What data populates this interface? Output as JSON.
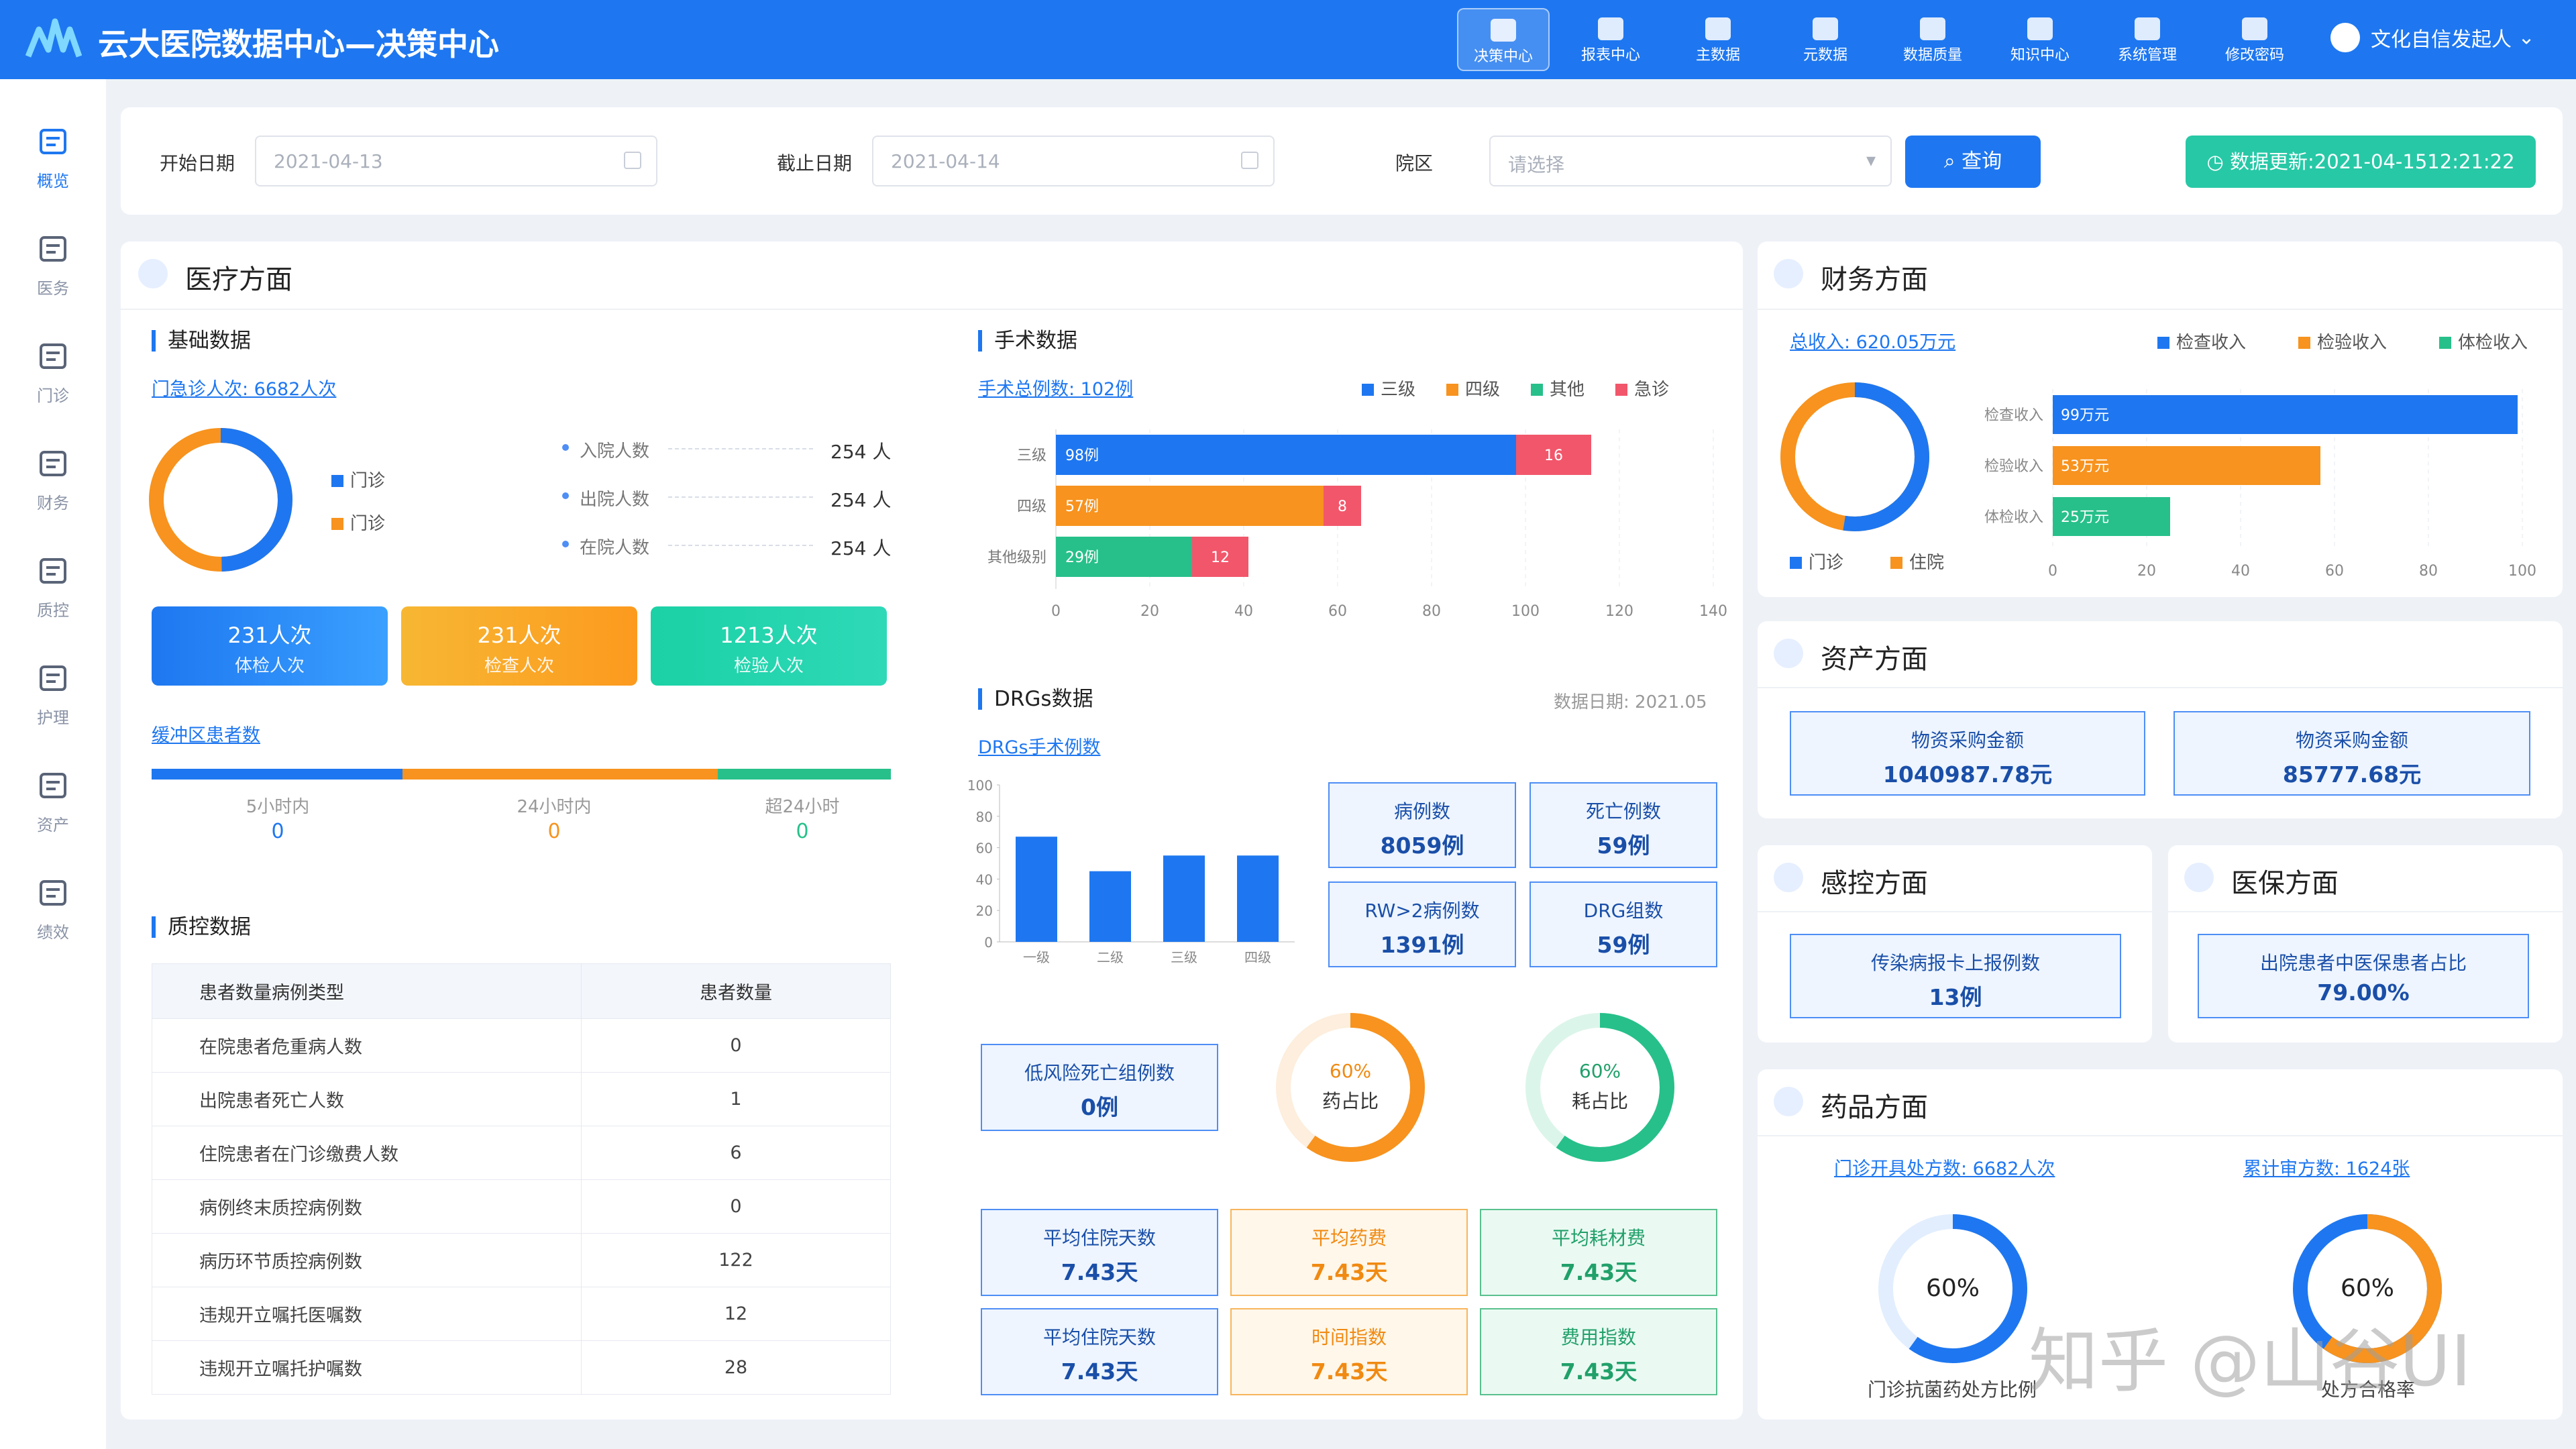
{
  "header": {
    "title": "云大医院数据中心—决策中心",
    "nav": [
      {
        "label": "决策中心",
        "icon": "decision-icon"
      },
      {
        "label": "报表中心",
        "icon": "pie-icon"
      },
      {
        "label": "主数据",
        "icon": "database-icon"
      },
      {
        "label": "元数据",
        "icon": "cubes-icon"
      },
      {
        "label": "数据质量",
        "icon": "shield-icon"
      },
      {
        "label": "知识中心",
        "icon": "book-icon"
      },
      {
        "label": "系统管理",
        "icon": "gear-icon"
      },
      {
        "label": "修改密码",
        "icon": "lock-icon"
      }
    ],
    "user": "文化自信发起人"
  },
  "sidebar": [
    {
      "label": "概览",
      "icon": "overview-icon"
    },
    {
      "label": "医务",
      "icon": "doctor-icon"
    },
    {
      "label": "门诊",
      "icon": "stethoscope-icon"
    },
    {
      "label": "财务",
      "icon": "finance-icon"
    },
    {
      "label": "质控",
      "icon": "quality-icon"
    },
    {
      "label": "护理",
      "icon": "clipboard-icon"
    },
    {
      "label": "资产",
      "icon": "monitor-icon"
    },
    {
      "label": "绩效",
      "icon": "growth-icon"
    }
  ],
  "filter": {
    "start_label": "开始日期",
    "start_value": "2021-04-13",
    "end_label": "截止日期",
    "end_value": "2021-04-14",
    "campus_label": "院区",
    "campus_placeholder": "请选择",
    "query": "查询",
    "update": "数据更新:2021-04-1512:21:22"
  },
  "medical": {
    "title": "医疗方面",
    "basic": {
      "title": "基础数据",
      "visits": "门急诊人次: 6682人次",
      "legend": [
        "门诊",
        "门诊"
      ],
      "stats": [
        {
          "label": "入院人数",
          "value": "254 人"
        },
        {
          "label": "出院人数",
          "value": "254 人"
        },
        {
          "label": "在院人数",
          "value": "254 人"
        }
      ],
      "cards": [
        {
          "value": "231人次",
          "label": "体检人次"
        },
        {
          "value": "231人次",
          "label": "检查人次"
        },
        {
          "value": "1213人次",
          "label": "检验人次"
        }
      ],
      "buffer": "缓冲区患者数",
      "buffer_items": [
        {
          "label": "5小时内",
          "value": "0"
        },
        {
          "label": "24小时内",
          "value": "0"
        },
        {
          "label": "超24小时",
          "value": "0"
        }
      ]
    },
    "qc": {
      "title": "质控数据",
      "headers": [
        "患者数量病例类型",
        "患者数量"
      ],
      "rows": [
        [
          "在院患者危重病人数",
          "0"
        ],
        [
          "出院患者死亡人数",
          "1"
        ],
        [
          "住院患者在门诊缴费人数",
          "6"
        ],
        [
          "病例终末质控病例数",
          "0"
        ],
        [
          "病历环节质控病例数",
          "122"
        ],
        [
          "违规开立嘱托医嘱数",
          "12"
        ],
        [
          "违规开立嘱托护嘱数",
          "28"
        ]
      ]
    },
    "surgery": {
      "title": "手术数据",
      "total": "手术总例数: 102例",
      "legend": [
        "三级",
        "四级",
        "其他",
        "急诊"
      ]
    },
    "drgs": {
      "title": "DRGs数据",
      "date": "数据日期: 2021.05",
      "sub": "DRGs手术例数",
      "boxes": [
        {
          "label": "病例数",
          "value": "8059例"
        },
        {
          "label": "死亡例数",
          "value": "59例"
        },
        {
          "label": "RW>2病例数",
          "value": "1391例"
        },
        {
          "label": "DRG组数",
          "value": "59例"
        }
      ],
      "lowrisk": {
        "label": "低风险死亡组例数",
        "value": "0例"
      },
      "ratio1": {
        "value": "60%",
        "label": "药占比"
      },
      "ratio2": {
        "value": "60%",
        "label": "耗占比"
      },
      "avg": [
        {
          "label": "平均住院天数",
          "value": "7.43天"
        },
        {
          "label": "平均药费",
          "value": "7.43天"
        },
        {
          "label": "平均耗材费",
          "value": "7.43天"
        },
        {
          "label": "平均住院天数",
          "value": "7.43天"
        },
        {
          "label": "时间指数",
          "value": "7.43天"
        },
        {
          "label": "费用指数",
          "value": "7.43天"
        }
      ]
    }
  },
  "finance": {
    "title": "财务方面",
    "total": "总收入: 620.05万元",
    "legend": [
      "检查收入",
      "检验收入",
      "体检收入"
    ],
    "donut_legend": [
      "门诊",
      "住院"
    ]
  },
  "assets": {
    "title": "资产方面",
    "items": [
      {
        "label": "物资采购金额",
        "value": "1040987.78元"
      },
      {
        "label": "物资采购金额",
        "value": "85777.68元"
      }
    ]
  },
  "infection": {
    "title": "感控方面",
    "label": "传染病报卡上报例数",
    "value": "13例"
  },
  "insurance": {
    "title": "医保方面",
    "label": "出院患者中医保患者占比",
    "value": "79.00%"
  },
  "drugs": {
    "title": "药品方面",
    "rx": "门诊开具处方数:   6682人次",
    "review": "累计审方数:  1624张",
    "g1": {
      "value": "60%",
      "label": "门诊抗菌药处方比例"
    },
    "g2": {
      "value": "60%",
      "label": "处方合格率"
    }
  },
  "watermark": "知乎 @山谷UI",
  "colors": {
    "primary": "#1e77f0",
    "orange": "#f7931e",
    "green": "#27c08a",
    "red": "#f2566b"
  },
  "chart_data": [
    {
      "type": "bar",
      "title": "手术数据",
      "orientation": "horizontal",
      "stacked": true,
      "categories": [
        "三级",
        "四级",
        "其他级别"
      ],
      "series": [
        {
          "name": "三级",
          "values": [
            98,
            null,
            null
          ],
          "labels": [
            "98例",
            "",
            ""
          ]
        },
        {
          "name": "四级",
          "values": [
            null,
            57,
            null
          ],
          "labels": [
            "",
            "57例",
            ""
          ]
        },
        {
          "name": "其他",
          "values": [
            null,
            null,
            29
          ],
          "labels": [
            "",
            "",
            "29例"
          ]
        },
        {
          "name": "急诊",
          "values": [
            16,
            8,
            12
          ],
          "labels": [
            "16",
            "8",
            "12"
          ]
        }
      ],
      "xlim": [
        0,
        140
      ],
      "xticks": [
        0,
        20,
        40,
        60,
        80,
        100,
        120,
        140
      ],
      "grid": true
    },
    {
      "type": "bar",
      "title": "DRGs手术例数",
      "categories": [
        "一级",
        "二级",
        "三级",
        "四级"
      ],
      "values": [
        67,
        45,
        55,
        55
      ],
      "ylim": [
        0,
        100
      ],
      "yticks": [
        0,
        20,
        40,
        60,
        80,
        100
      ]
    },
    {
      "type": "bar",
      "title": "财务方面",
      "orientation": "horizontal",
      "categories": [
        "检查收入",
        "检验收入",
        "体检收入"
      ],
      "values": [
        99,
        57,
        25
      ],
      "labels": [
        "99万元",
        "53万元",
        "25万元"
      ],
      "xlim": [
        0,
        100
      ],
      "xticks": [
        0,
        20,
        40,
        60,
        80,
        100
      ]
    }
  ]
}
